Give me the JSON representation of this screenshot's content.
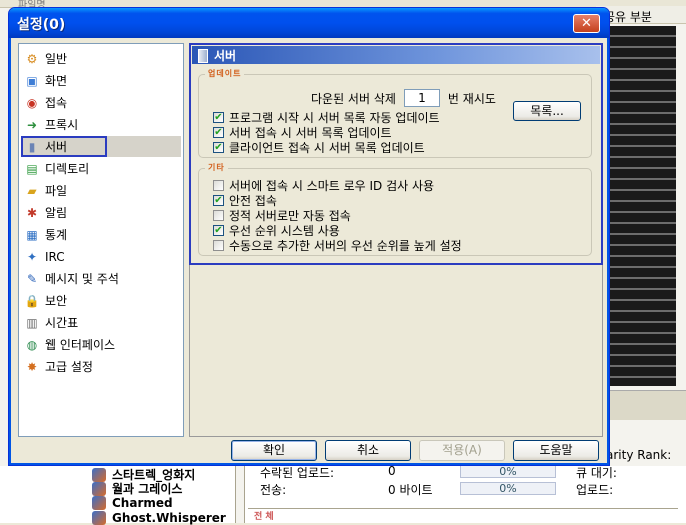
{
  "background": {
    "top_strip_text": "파일명",
    "right_header": "공유 부분",
    "tree_items": [
      "스타트렉_엉화지",
      "월과 그레이스",
      "Charmed",
      "Ghost.Whisperer"
    ],
    "stats": {
      "rank_label": "arity Rank:",
      "row1_label": "수락된 업로드:",
      "row1_value": "0",
      "row1_pct": "0%",
      "row1_right": "큐 대기:",
      "row2_label": "전송:",
      "row2_value": "0 바이트",
      "row2_pct": "0%",
      "row2_right": "업로드:",
      "section": "전 체"
    }
  },
  "dialog": {
    "title": "설정(0)",
    "close_glyph": "✕"
  },
  "nav": {
    "items": [
      {
        "label": "일반",
        "icon": "gear-icon",
        "glyph": "⚙",
        "color": "#d78a1c"
      },
      {
        "label": "화면",
        "icon": "display-icon",
        "glyph": "▣",
        "color": "#3f7ed6"
      },
      {
        "label": "접속",
        "icon": "connection-icon",
        "glyph": "◉",
        "color": "#c83323"
      },
      {
        "label": "프록시",
        "icon": "proxy-icon",
        "glyph": "➜",
        "color": "#2e8f3e"
      },
      {
        "label": "서버",
        "icon": "server-icon",
        "glyph": "▮",
        "color": "#6b84b5"
      },
      {
        "label": "디렉토리",
        "icon": "directory-icon",
        "glyph": "▤",
        "color": "#2f9a3e"
      },
      {
        "label": "파일",
        "icon": "file-icon",
        "glyph": "▰",
        "color": "#d9a41e"
      },
      {
        "label": "알림",
        "icon": "notification-icon",
        "glyph": "✱",
        "color": "#c23a2b"
      },
      {
        "label": "통계",
        "icon": "statistics-icon",
        "glyph": "▦",
        "color": "#2b6ec3"
      },
      {
        "label": "IRC",
        "icon": "irc-icon",
        "glyph": "✦",
        "color": "#3070c2"
      },
      {
        "label": "메시지 및 주석",
        "icon": "message-icon",
        "glyph": "✎",
        "color": "#2a62b8"
      },
      {
        "label": "보안",
        "icon": "lock-icon",
        "glyph": "🔒",
        "color": "#c99a1a"
      },
      {
        "label": "시간표",
        "icon": "calendar-icon",
        "glyph": "▥",
        "color": "#6d6d6d"
      },
      {
        "label": "웹 인터페이스",
        "icon": "web-icon",
        "glyph": "◍",
        "color": "#2b8a4d"
      },
      {
        "label": "고급 설정",
        "icon": "advanced-icon",
        "glyph": "✸",
        "color": "#d46f1f"
      }
    ],
    "selected_index": 4
  },
  "server_panel": {
    "header": "서버",
    "update_group": {
      "legend": "업데이트",
      "retry_prefix": "다운된 서버 삭제",
      "retry_value": "1",
      "retry_suffix": "번 재시도",
      "list_button": "목록...",
      "options": [
        {
          "label": "프로그램 시작 시 서버 목록 자동 업데이트",
          "checked": true
        },
        {
          "label": "서버 접속 시 서버 목록 업데이트",
          "checked": true
        },
        {
          "label": "클라이언트 접속 시 서버 목록 업데이트",
          "checked": true
        }
      ]
    },
    "misc_group": {
      "legend": "기타",
      "options": [
        {
          "label": "서버에 접속 시 스마트 로우 ID 검사 사용",
          "checked": false
        },
        {
          "label": "안전 접속",
          "checked": true
        },
        {
          "label": "정적 서버로만 자동 접속",
          "checked": false
        },
        {
          "label": "우선 순위 시스템 사용",
          "checked": true
        },
        {
          "label": "수동으로 추가한 서버의 우선 순위를 높게 설정",
          "checked": false
        }
      ]
    }
  },
  "buttons": {
    "ok": "확인",
    "cancel": "취소",
    "apply": "적용(A)",
    "help": "도움말"
  },
  "check_glyph": "✔"
}
